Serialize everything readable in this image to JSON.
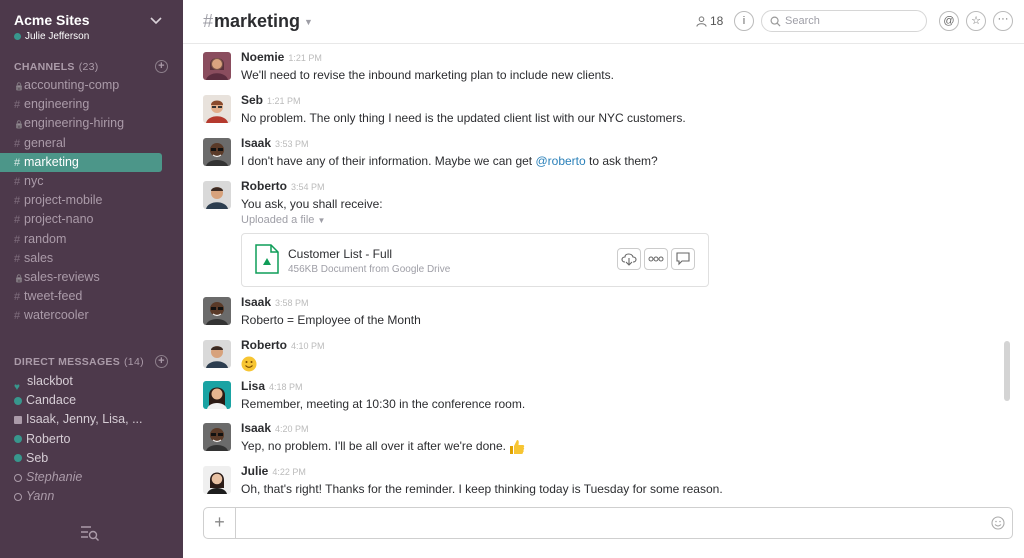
{
  "team": {
    "name": "Acme Sites",
    "user": "Julie Jefferson"
  },
  "channels": {
    "title": "CHANNELS",
    "count": "(23)",
    "items": [
      {
        "name": "accounting-comp",
        "private": true,
        "active": false
      },
      {
        "name": "engineering",
        "private": false,
        "active": false
      },
      {
        "name": "engineering-hiring",
        "private": true,
        "active": false
      },
      {
        "name": "general",
        "private": false,
        "active": false
      },
      {
        "name": "marketing",
        "private": false,
        "active": true
      },
      {
        "name": "nyc",
        "private": false,
        "active": false
      },
      {
        "name": "project-mobile",
        "private": false,
        "active": false
      },
      {
        "name": "project-nano",
        "private": false,
        "active": false
      },
      {
        "name": "random",
        "private": false,
        "active": false
      },
      {
        "name": "sales",
        "private": false,
        "active": false
      },
      {
        "name": "sales-reviews",
        "private": true,
        "active": false
      },
      {
        "name": "tweet-feed",
        "private": false,
        "active": false
      },
      {
        "name": "watercooler",
        "private": false,
        "active": false
      }
    ]
  },
  "direct_messages": {
    "title": "DIRECT MESSAGES",
    "count": "(14)",
    "items": [
      {
        "name": "slackbot",
        "status": "heart"
      },
      {
        "name": "Candace",
        "status": "online"
      },
      {
        "name": "Isaak, Jenny, Lisa, ...",
        "status": "group"
      },
      {
        "name": "Roberto",
        "status": "online"
      },
      {
        "name": "Seb",
        "status": "online"
      },
      {
        "name": "Stephanie",
        "status": "away"
      },
      {
        "name": "Yann",
        "status": "away"
      }
    ]
  },
  "header": {
    "hash": "#",
    "channel": "marketing",
    "member_count": "18",
    "search_placeholder": "Search"
  },
  "messages": [
    {
      "sender": "Noemie",
      "time": "1:21 PM",
      "text": "We'll need to revise the inbound marketing plan to include new clients."
    },
    {
      "sender": "Seb",
      "time": "1:21 PM",
      "text": "No problem. The only thing I need is the updated client list with our NYC customers."
    },
    {
      "sender": "Isaak",
      "time": "3:53 PM",
      "text_before": "I don't have any of their information. Maybe we can get ",
      "mention": "@roberto",
      "text_after": " to ask them?"
    },
    {
      "sender": "Roberto",
      "time": "3:54 PM",
      "text": "You ask, you shall receive:",
      "sub": "Uploaded a file",
      "file": {
        "name": "Customer List - Full",
        "desc": "456KB Document from Google Drive"
      }
    },
    {
      "sender": "Isaak",
      "time": "3:58 PM",
      "text": "Roberto = Employee of the Month"
    },
    {
      "sender": "Roberto",
      "time": "4:10 PM",
      "emoji": "smile"
    },
    {
      "sender": "Lisa",
      "time": "4:18 PM",
      "text": "Remember, meeting at 10:30 in the conference room."
    },
    {
      "sender": "Isaak",
      "time": "4:20 PM",
      "text": "Yep, no problem. I'll be all over it after we're done.",
      "emoji": "thumbs-up"
    },
    {
      "sender": "Julie",
      "time": "4:22 PM",
      "text": "Oh, that's right! Thanks for the reminder. I keep thinking today is Tuesday for some reason."
    }
  ],
  "colors": {
    "sidebar": "#4d394b",
    "active_channel": "#4c9689",
    "presence": "#38978d",
    "mention": "#2a80b9"
  }
}
